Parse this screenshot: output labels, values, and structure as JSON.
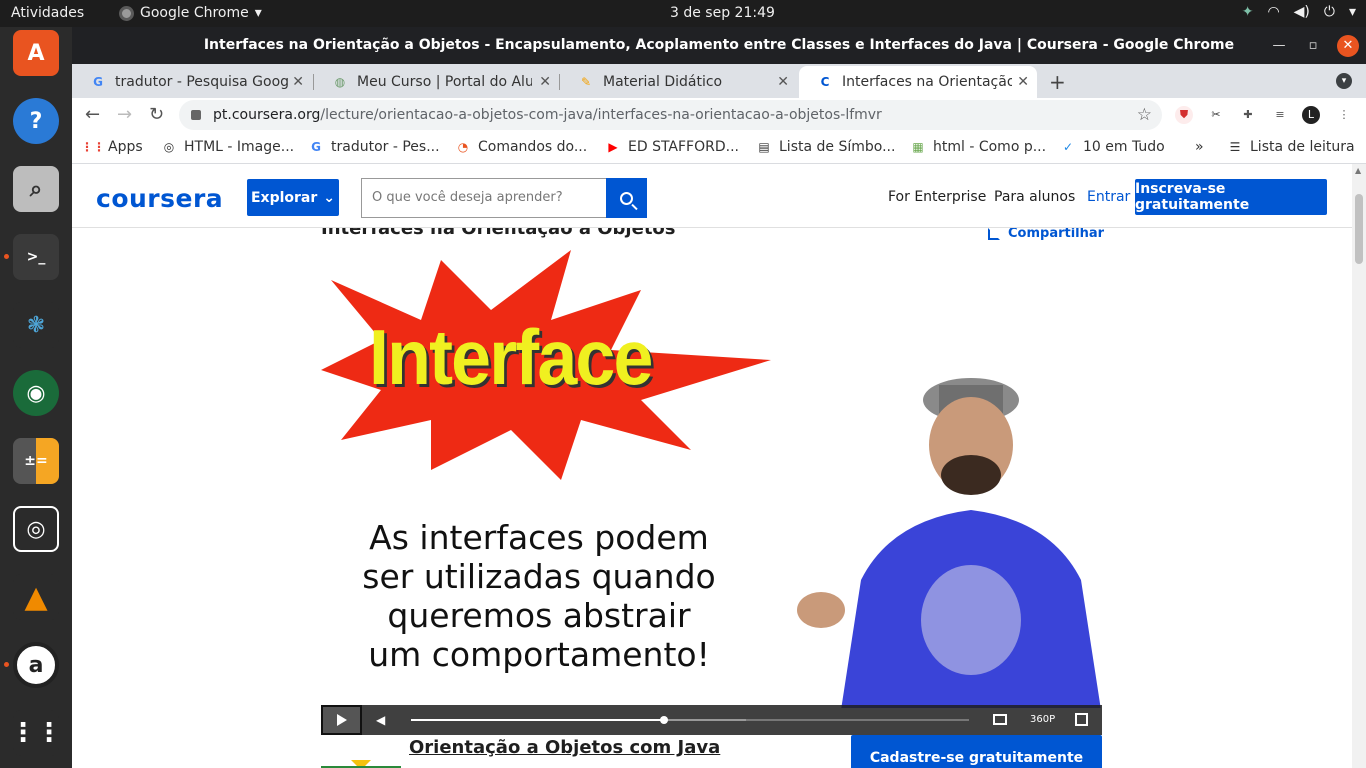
{
  "desktop": {
    "activities": "Atividades",
    "app_name": "Google Chrome",
    "clock": "3 de sep  21:49"
  },
  "window": {
    "title": "Interfaces na Orientação a Objetos - Encapsulamento, Acoplamento entre Classes e Interfaces do Java | Coursera - Google Chrome"
  },
  "tabs": [
    {
      "title": "tradutor - Pesquisa Googl",
      "favicon": "google-icon"
    },
    {
      "title": "Meu Curso | Portal do Alu",
      "favicon": "portal-icon"
    },
    {
      "title": "Material Didático",
      "favicon": "pencil-icon"
    },
    {
      "title": "Interfaces na Orientação",
      "favicon": "coursera-icon",
      "active": true
    }
  ],
  "address": {
    "host": "pt.coursera.org",
    "path": "/lecture/orientacao-a-objetos-com-java/interfaces-na-orientacao-a-objetos-lfmvr"
  },
  "bookmarks": [
    {
      "label": "Apps",
      "icon": "apps-grid-icon"
    },
    {
      "label": "HTML - Image...",
      "icon": "globe-icon"
    },
    {
      "label": "tradutor - Pes...",
      "icon": "google-icon"
    },
    {
      "label": "Comandos do...",
      "icon": "ubuntu-icon"
    },
    {
      "label": "ED STAFFORD...",
      "icon": "youtube-icon"
    },
    {
      "label": "Lista de Símbo...",
      "icon": "page-icon"
    },
    {
      "label": "html - Como p...",
      "icon": "stackoverflow-icon"
    },
    {
      "label": "10 em Tudo",
      "icon": "check-icon"
    }
  ],
  "bookmarks_more": "»",
  "reading_list": "Lista de leitura",
  "coursera": {
    "logo": "coursera",
    "explore": "Explorar",
    "search_placeholder": "O que você deseja aprender?",
    "for_enterprise": "For Enterprise",
    "para_alunos": "Para alunos",
    "entrar": "Entrar",
    "inscreva": "Inscreva-se gratuitamente"
  },
  "lecture": {
    "title": "Interfaces na Orientação a Objetos",
    "share": "Compartilhar"
  },
  "video": {
    "headline": "Interface",
    "caption_lines": [
      "As interfaces podem",
      "ser utilizadas quando",
      "queremos abstrair",
      "um comportamento!"
    ],
    "quality": "360P",
    "progress": 0.454,
    "buffered": 0.6
  },
  "course": {
    "name": "Orientação a Objetos com Java",
    "signup": "Cadastre-se gratuitamente"
  },
  "colors": {
    "coursera_blue": "#0056d2",
    "ubuntu_orange": "#e95420"
  }
}
